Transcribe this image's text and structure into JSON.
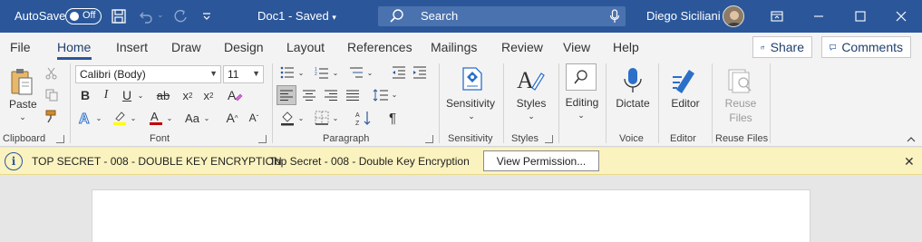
{
  "titlebar": {
    "autosave_label": "AutoSave",
    "autosave_state": "Off",
    "doc_title": "Doc1  -  Saved",
    "search_placeholder": "Search",
    "user_name": "Diego Siciliani",
    "bg_color": "#2b579a"
  },
  "tabs": [
    "File",
    "Home",
    "Insert",
    "Draw",
    "Design",
    "Layout",
    "References",
    "Mailings",
    "Review",
    "View",
    "Help"
  ],
  "active_tab": "Home",
  "share_label": "Share",
  "comments_label": "Comments",
  "ribbon": {
    "paste_label": "Paste",
    "font_name": "Calibri (Body)",
    "font_size": "11",
    "groups": {
      "clipboard": "Clipboard",
      "font": "Font",
      "paragraph": "Paragraph",
      "sensitivity": "Sensitivity",
      "styles": "Styles",
      "voice": "Voice",
      "editor": "Editor",
      "reuse_files": "Reuse Files"
    },
    "buttons": {
      "sensitivity": "Sensitivity",
      "styles": "Styles",
      "editing": "Editing",
      "dictate": "Dictate",
      "editor": "Editor",
      "reuse_line1": "Reuse",
      "reuse_line2": "Files"
    }
  },
  "infobar": {
    "title": "TOP SECRET - 008 - DOUBLE KEY ENCRYPTION",
    "message": "Top Secret - 008 - Double Key Encryption",
    "button": "View Permission...",
    "bg_color": "#fbf3bf"
  }
}
